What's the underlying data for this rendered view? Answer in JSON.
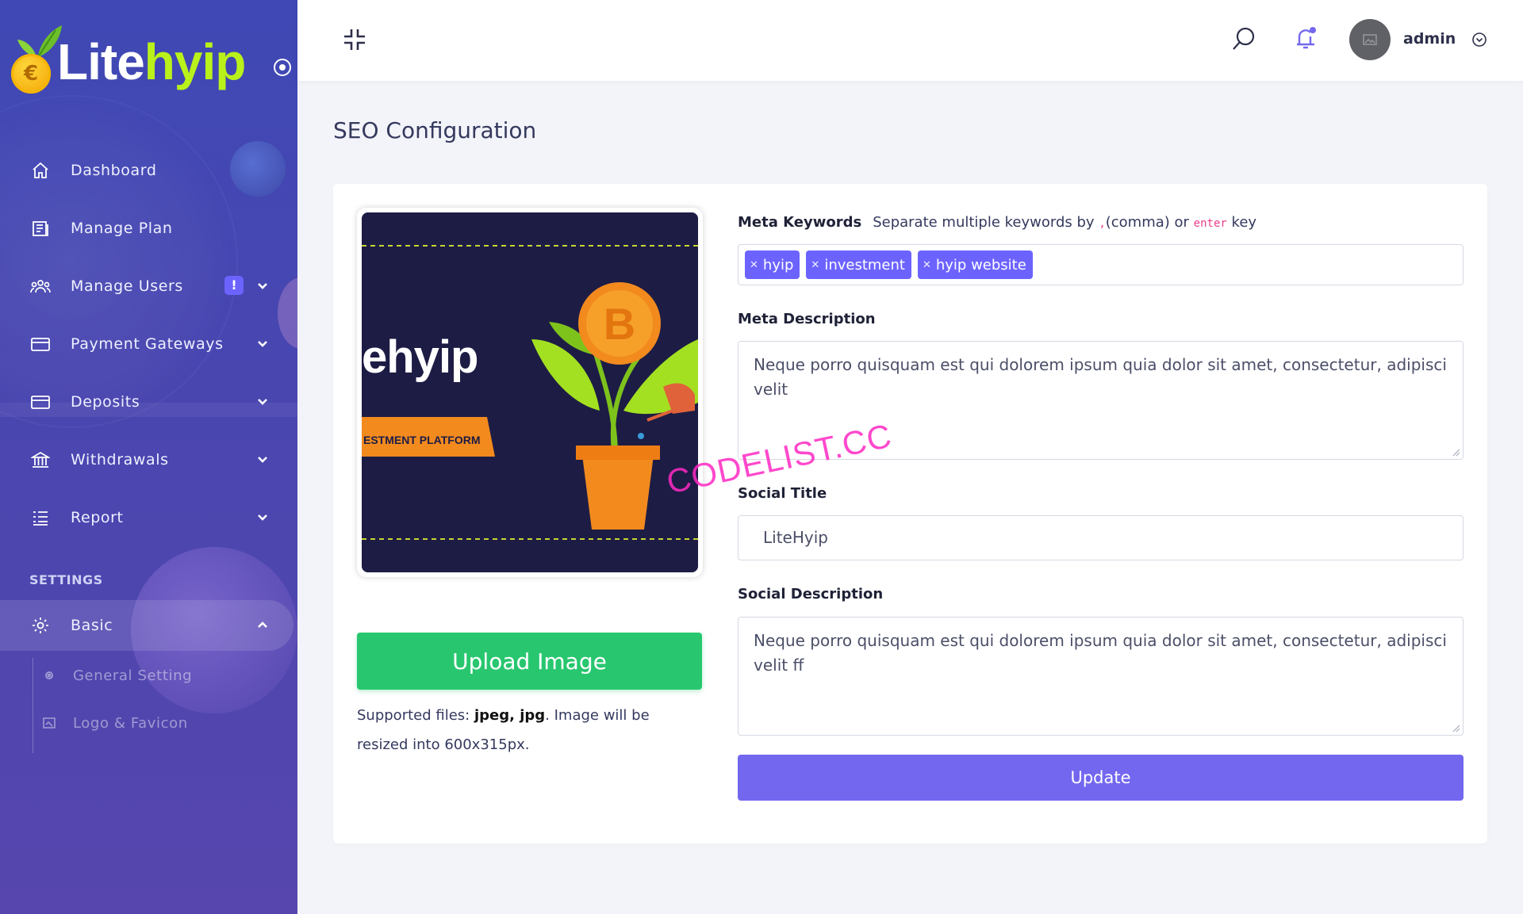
{
  "brand": {
    "name_part1": "Lite",
    "name_part2": "hyip",
    "coin_symbol": "€"
  },
  "colors": {
    "sidebar_gradient": [
      "#3f48b5",
      "#5646ad"
    ],
    "accent_purple": "#7367f0",
    "badge_purple": "#6c63ff",
    "upload_green": "#28c76f",
    "logo_green": "#b9f11a",
    "watermark_pink": "#ff29c4"
  },
  "sidebar": {
    "items": [
      {
        "label": "Dashboard",
        "icon": "home-icon",
        "has_caret": false
      },
      {
        "label": "Manage Plan",
        "icon": "plan-icon",
        "has_caret": false
      },
      {
        "label": "Manage Users",
        "icon": "users-icon",
        "has_caret": true,
        "badge": "!"
      },
      {
        "label": "Payment Gateways",
        "icon": "credit-card-icon",
        "has_caret": true
      },
      {
        "label": "Deposits",
        "icon": "credit-card-icon",
        "has_caret": true
      },
      {
        "label": "Withdrawals",
        "icon": "bank-icon",
        "has_caret": true
      },
      {
        "label": "Report",
        "icon": "list-icon",
        "has_caret": true
      }
    ],
    "settings_heading": "SETTINGS",
    "basic": {
      "label": "Basic",
      "icon": "gear-icon",
      "expanded": true
    },
    "sub_items": [
      {
        "label": "General Setting",
        "icon": "gear-icon"
      },
      {
        "label": "Logo & Favicon",
        "icon": "image-icon"
      }
    ]
  },
  "topbar": {
    "icons": [
      "collapse-icon",
      "search-icon",
      "bell-icon",
      "chevron-down-icon"
    ],
    "user_name": "admin"
  },
  "page": {
    "title": "SEO Configuration",
    "image_text": {
      "brand_fragment": "ehyip",
      "banner": "ESTMENT PLATFORM",
      "coin_symbol": "B"
    },
    "upload_button": "Upload Image",
    "supported_prefix": "Supported files: ",
    "supported_formats": "jpeg, jpg",
    "supported_suffix": ". Image will be resized into 600x315px.",
    "meta_keywords": {
      "label": "Meta Keywords",
      "hint_prefix": "Separate multiple keywords by ",
      "hint_comma": ",",
      "hint_mid": "(comma) or ",
      "hint_enter": "enter",
      "hint_suffix": " key",
      "tags": [
        "hyip",
        "investment",
        "hyip website"
      ]
    },
    "meta_description": {
      "label": "Meta Description",
      "value": "Neque porro quisquam est qui dolorem ipsum quia dolor sit amet, consectetur, adipisci velit"
    },
    "social_title": {
      "label": "Social Title",
      "value": "LiteHyip"
    },
    "social_description": {
      "label": "Social Description",
      "value": "Neque porro quisquam est qui dolorem ipsum quia dolor sit amet, consectetur, adipisci velit ff"
    },
    "update_button": "Update"
  },
  "watermark": "CODELIST.CC"
}
